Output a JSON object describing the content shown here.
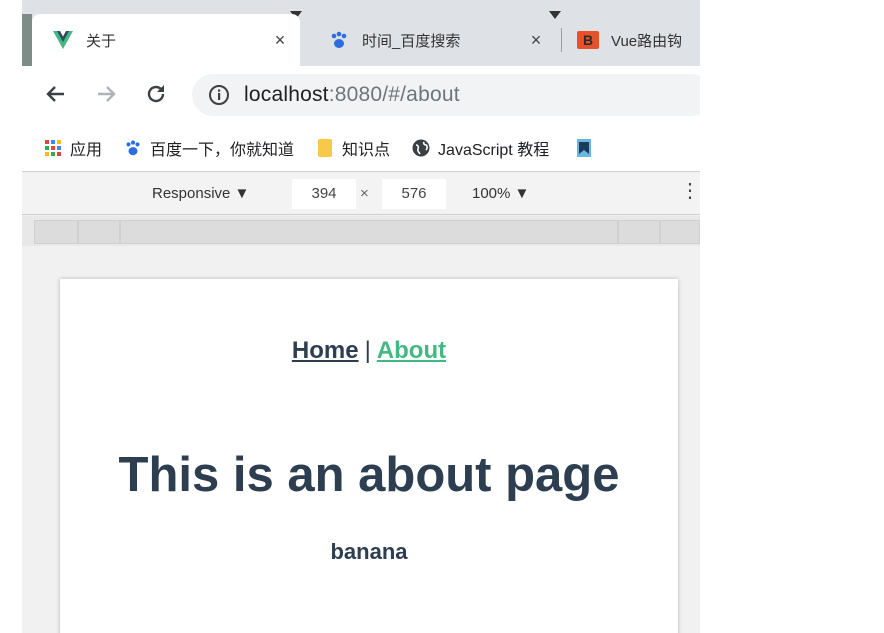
{
  "tabs": [
    {
      "title": "关于",
      "close": "×",
      "icon": "vue-logo-icon",
      "active": true
    },
    {
      "title": "时间_百度搜索",
      "close": "×",
      "icon": "baidu-paw-icon",
      "active": false
    },
    {
      "title": "Vue路由钩",
      "icon": "jetbrains-icon",
      "active": false
    }
  ],
  "address": {
    "host": "localhost",
    "rest": ":8080/#/about"
  },
  "bookmarks": [
    {
      "label": "应用",
      "icon": "apps-grid-icon"
    },
    {
      "label": "百度一下，你就知道",
      "icon": "baidu-paw-icon"
    },
    {
      "label": "知识点",
      "icon": "folder-icon"
    },
    {
      "label": "JavaScript 教程",
      "icon": "globe-icon"
    }
  ],
  "devtools": {
    "device": "Responsive ▼",
    "width": "394",
    "times": "×",
    "height": "576",
    "zoom": "100% ▼",
    "more": "⋮"
  },
  "page": {
    "nav_home": "Home",
    "nav_sep": "|",
    "nav_about": "About",
    "heading": "This is an about page",
    "subtext": "banana"
  },
  "colors": {
    "vue_green": "#42b983",
    "text": "#2c3e50"
  }
}
